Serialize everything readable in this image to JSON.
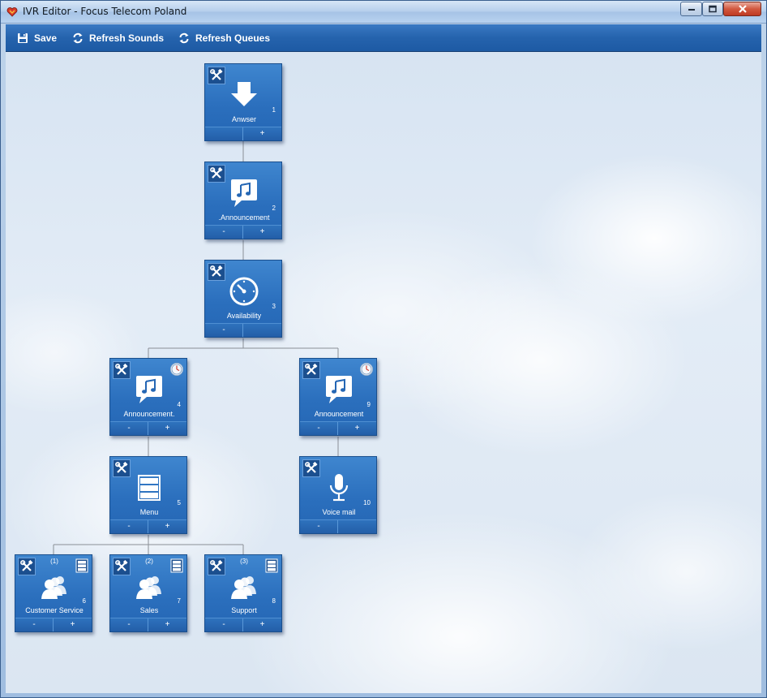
{
  "window": {
    "title": "IVR Editor - Focus Telecom Poland"
  },
  "toolbar": {
    "save_label": "Save",
    "refresh_sounds_label": "Refresh Sounds",
    "refresh_queues_label": "Refresh Queues"
  },
  "nodes": [
    {
      "id": "1",
      "label": "Anwser",
      "icon": "arrow-down-icon",
      "minus": "",
      "plus": "+",
      "clock": false,
      "menu": false,
      "option": ""
    },
    {
      "id": "2",
      "label": ".Announcement",
      "icon": "music-message-icon",
      "minus": "-",
      "plus": "+",
      "clock": false,
      "menu": false,
      "option": ""
    },
    {
      "id": "3",
      "label": "Availability",
      "icon": "clock-icon",
      "minus": "-",
      "plus": "",
      "clock": false,
      "menu": false,
      "option": ""
    },
    {
      "id": "4",
      "label": "Announcement.",
      "icon": "music-message-icon",
      "minus": "-",
      "plus": "+",
      "clock": true,
      "menu": false,
      "option": ""
    },
    {
      "id": "9",
      "label": "Announcement",
      "icon": "music-message-icon",
      "minus": "-",
      "plus": "+",
      "clock": true,
      "menu": false,
      "option": ""
    },
    {
      "id": "5",
      "label": "Menu",
      "icon": "menu-icon",
      "minus": "-",
      "plus": "+",
      "clock": false,
      "menu": false,
      "option": ""
    },
    {
      "id": "10",
      "label": "Voice mail",
      "icon": "microphone-icon",
      "minus": "-",
      "plus": "",
      "clock": false,
      "menu": false,
      "option": ""
    },
    {
      "id": "6",
      "label": "Customer Service",
      "icon": "users-icon",
      "minus": "-",
      "plus": "+",
      "clock": false,
      "menu": true,
      "option": "(1)"
    },
    {
      "id": "7",
      "label": "Sales",
      "icon": "users-icon",
      "minus": "-",
      "plus": "+",
      "clock": false,
      "menu": true,
      "option": "(2)"
    },
    {
      "id": "8",
      "label": "Support",
      "icon": "users-icon",
      "minus": "-",
      "plus": "+",
      "clock": false,
      "menu": true,
      "option": "(3)"
    }
  ],
  "colors": {
    "node_blue": "#2b6fbd",
    "toolbar_blue": "#2563ad",
    "connector": "#8a8f96"
  }
}
